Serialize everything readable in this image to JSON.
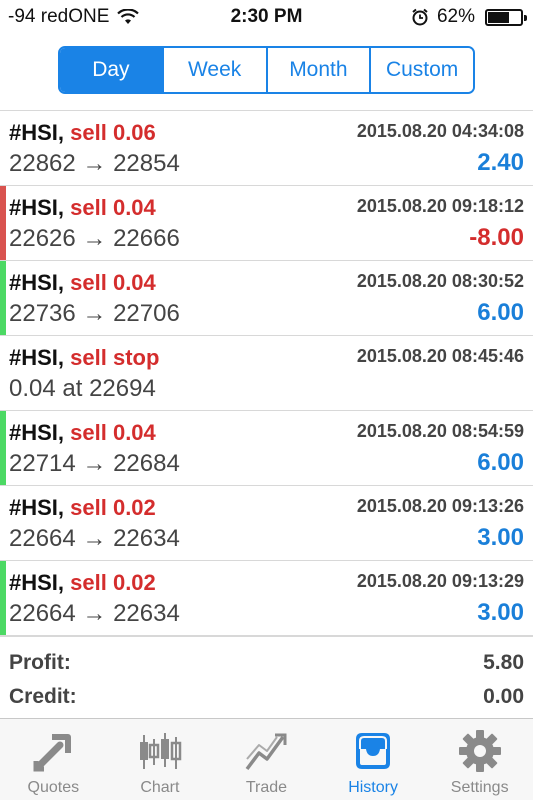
{
  "status_bar": {
    "signal": "-94 redONE",
    "time": "2:30 PM",
    "battery": "62%",
    "battery_level": 0.62
  },
  "periods": [
    {
      "label": "Day",
      "active": true
    },
    {
      "label": "Week",
      "active": false
    },
    {
      "label": "Month",
      "active": false
    },
    {
      "label": "Custom",
      "active": false
    }
  ],
  "rows": [
    {
      "symbol": "#HSI,",
      "action": "sell 0.06",
      "time": "2015.08.20 04:34:08",
      "prices": "22862 → 22854",
      "pl": "2.40",
      "pl_type": "pos",
      "stripe": "",
      "faded": false
    },
    {
      "symbol": "#HSI,",
      "action": "sell 0.04",
      "time": "2015.08.20 09:18:12",
      "prices": "22626 → 22666",
      "pl": "-8.00",
      "pl_type": "neg",
      "stripe": "#d9534f",
      "faded": false
    },
    {
      "symbol": "#HSI,",
      "action": "sell 0.04",
      "time": "2015.08.20 08:30:52",
      "prices": "22736 → 22706",
      "pl": "6.00",
      "pl_type": "pos",
      "stripe": "#4cd964",
      "faded": false
    },
    {
      "symbol": "#HSI,",
      "action": "sell stop",
      "time": "2015.08.20 08:45:46",
      "prices": "0.04 at 22694",
      "pl": "",
      "pl_type": "pos",
      "stripe": "",
      "faded": false
    },
    {
      "symbol": "#HSI,",
      "action": "sell 0.04",
      "time": "2015.08.20 08:54:59",
      "prices": "22714 → 22684",
      "pl": "6.00",
      "pl_type": "pos",
      "stripe": "#4cd964",
      "faded": false
    },
    {
      "symbol": "#HSI,",
      "action": "sell 0.02",
      "time": "2015.08.20 09:13:26",
      "prices": "22664 → 22634",
      "pl": "3.00",
      "pl_type": "pos",
      "stripe": "",
      "faded": false
    },
    {
      "symbol": "#HSI,",
      "action": "sell 0.02",
      "time": "2015.08.20 09:13:29",
      "prices": "22664 → 22634",
      "pl": "3.00",
      "pl_type": "pos",
      "stripe": "#4cd964",
      "faded": false
    }
  ],
  "totals": {
    "profit_label": "Profit:",
    "profit_value": "5.80",
    "credit_label": "Credit:",
    "credit_value": "0.00"
  },
  "tabs": [
    {
      "label": "Quotes",
      "icon": "quotes-icon",
      "active": false
    },
    {
      "label": "Chart",
      "icon": "chart-icon",
      "active": false
    },
    {
      "label": "Trade",
      "icon": "trade-icon",
      "active": false
    },
    {
      "label": "History",
      "icon": "history-icon",
      "active": true
    },
    {
      "label": "Settings",
      "icon": "settings-icon",
      "active": false
    }
  ],
  "colors": {
    "accent": "#1a83e6",
    "sell": "#d42d2d",
    "profit_positive": "#1a7fd9",
    "profit_negative": "#d42d2d",
    "stripe_green": "#4cd964",
    "stripe_red": "#d9534f"
  }
}
